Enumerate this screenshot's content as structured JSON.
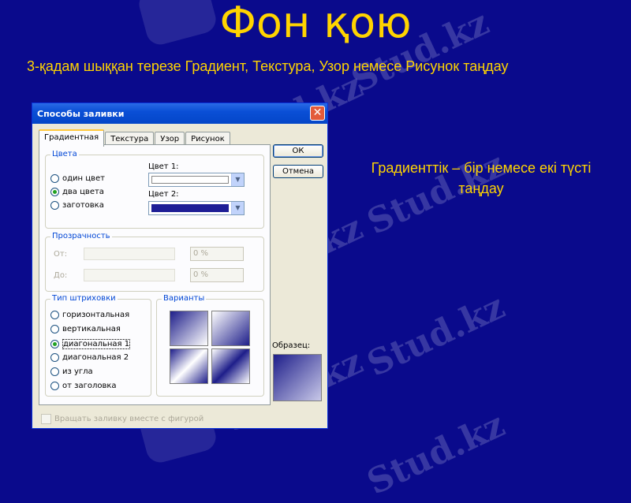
{
  "slide": {
    "title": "Фон қою",
    "subtitle": "3-қадам шыққан терезе Градиент, Текстура, Узор немесе Рисунок таңдау",
    "note": "Градиенттік – бір немесе екі түсті таңдау",
    "watermark": "Stud.kz"
  },
  "dialog": {
    "title": "Способы заливки",
    "tabs": [
      "Градиентная",
      "Текстура",
      "Узор",
      "Рисунок"
    ],
    "colors_group": {
      "label": "Цвета",
      "options": [
        "один цвет",
        "два цвета",
        "заготовка"
      ],
      "selected": "два цвета",
      "color1_label": "Цвет 1:",
      "color2_label": "Цвет 2:",
      "color1": "#ffffff",
      "color2": "#1e1e96"
    },
    "transparency": {
      "label": "Прозрачность",
      "from_label": "От:",
      "to_label": "До:",
      "from_value": "0 %",
      "to_value": "0 %"
    },
    "shading": {
      "label": "Тип штриховки",
      "options": [
        "горизонтальная",
        "вертикальная",
        "диагональная 1",
        "диагональная 2",
        "из угла",
        "от заголовка"
      ],
      "selected": "диагональная 1",
      "variants_label": "Варианты"
    },
    "ok_label": "ОК",
    "cancel_label": "Отмена",
    "sample_label": "Образец:",
    "rotate_label": "Вращать заливку вместе с фигурой"
  },
  "colors": {
    "background": "#0a0a8c",
    "accent": "#ffd400"
  }
}
